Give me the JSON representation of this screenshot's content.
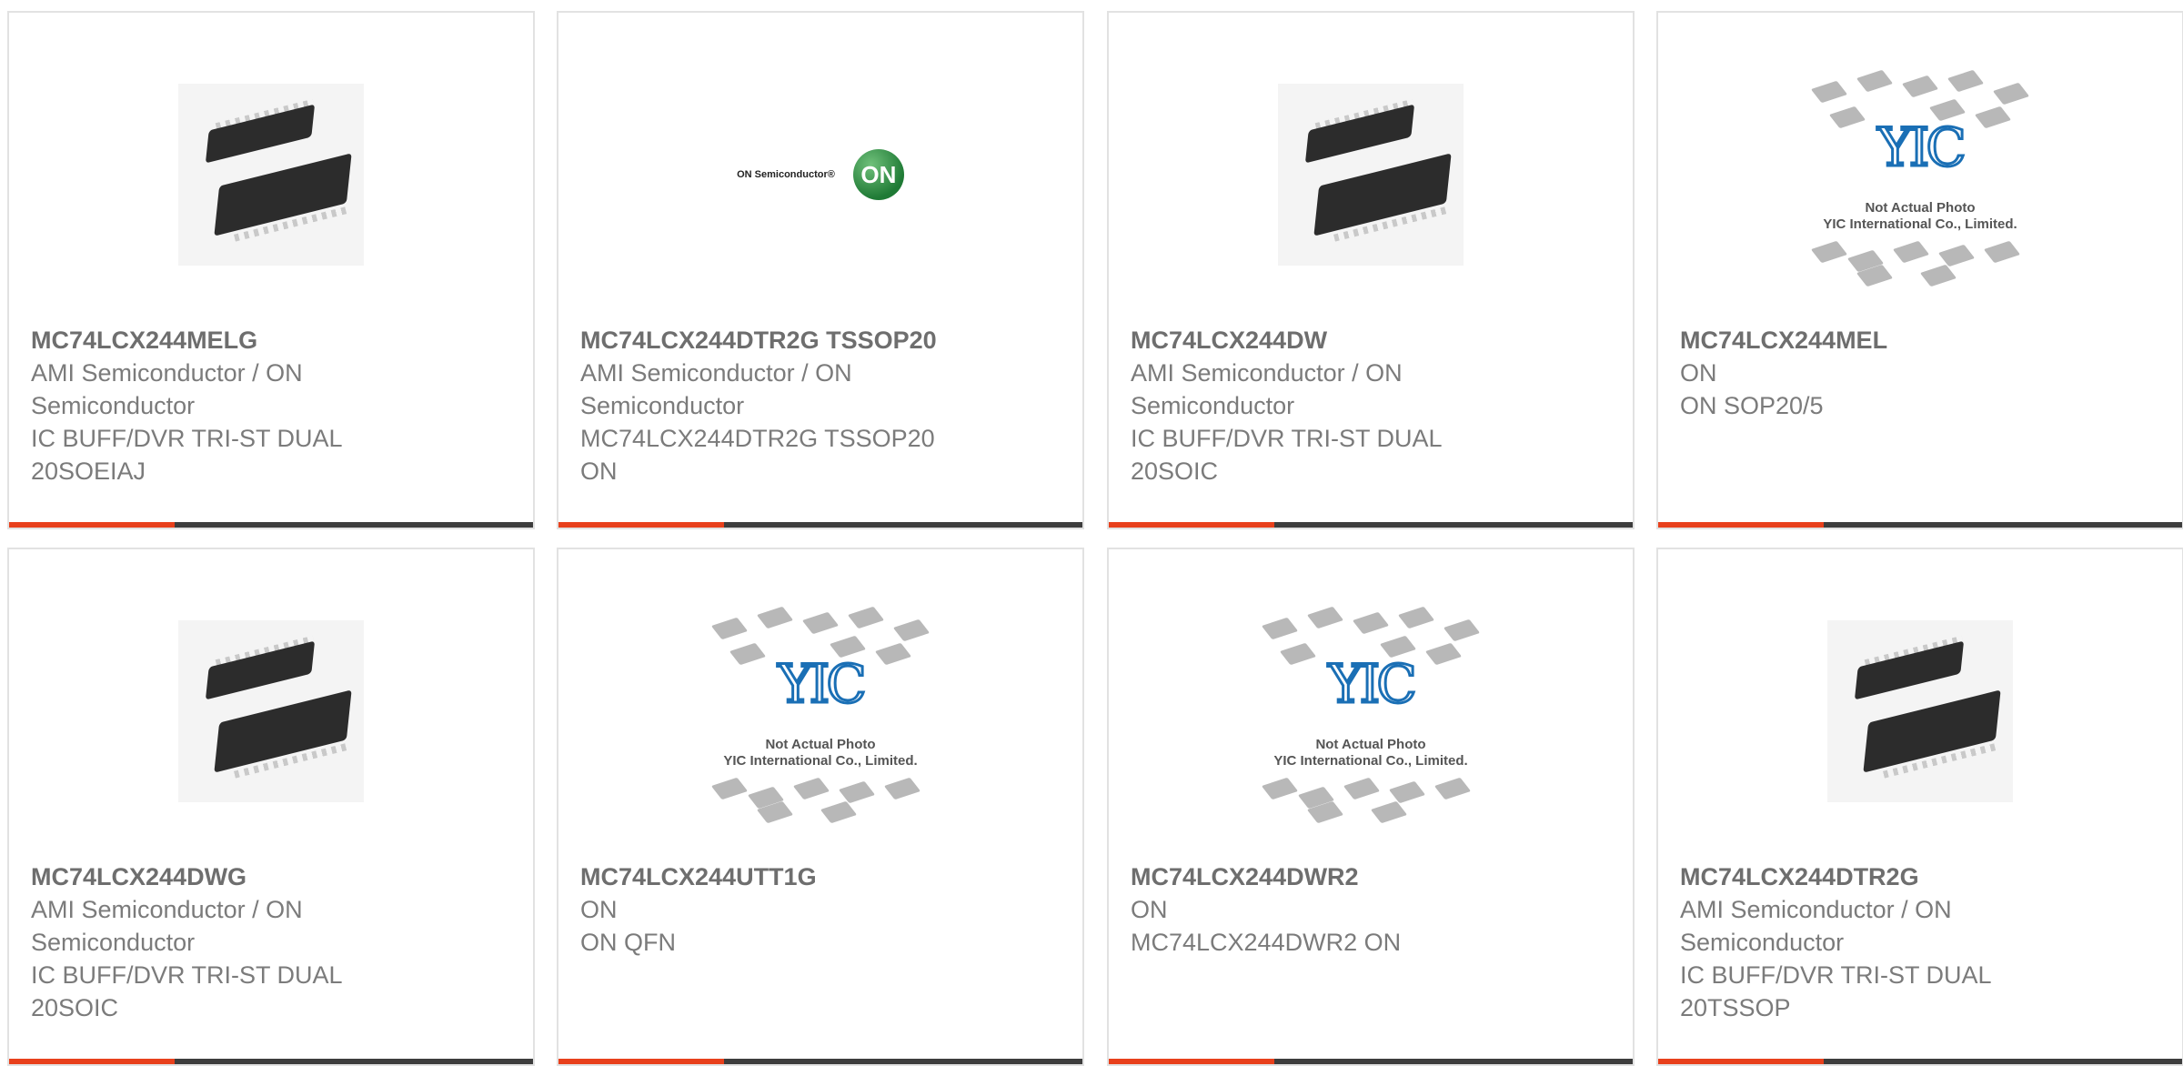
{
  "products": [
    {
      "part_number": "MC74LCX244MELG",
      "lines": [
        "AMI Semiconductor / ON",
        "Semiconductor",
        "IC BUFF/DVR TRI-ST DUAL",
        "20SOEIAJ"
      ],
      "image": "chip-photo"
    },
    {
      "part_number": "MC74LCX244DTR2G TSSOP20",
      "lines": [
        "AMI Semiconductor / ON",
        "Semiconductor",
        "MC74LCX244DTR2G TSSOP20",
        "ON"
      ],
      "image": "on-semiconductor-logo",
      "logo_text": "ON Semiconductor®",
      "logo_mark": "ON"
    },
    {
      "part_number": "MC74LCX244DW",
      "lines": [
        "AMI Semiconductor / ON",
        "Semiconductor",
        "IC BUFF/DVR TRI-ST DUAL",
        "20SOIC"
      ],
      "image": "chip-photo"
    },
    {
      "part_number": "MC74LCX244MEL",
      "lines": [
        "ON",
        "ON SOP20/5"
      ],
      "image": "not-actual-photo",
      "placeholder_mark": "YIC",
      "placeholder_caption": [
        "Not Actual Photo",
        "YIC International Co., Limited."
      ]
    },
    {
      "part_number": "MC74LCX244DWG",
      "lines": [
        "AMI Semiconductor / ON",
        "Semiconductor",
        "IC BUFF/DVR TRI-ST DUAL",
        "20SOIC"
      ],
      "image": "chip-photo"
    },
    {
      "part_number": "MC74LCX244UTT1G",
      "lines": [
        "ON",
        "ON QFN"
      ],
      "image": "not-actual-photo",
      "placeholder_mark": "YIC",
      "placeholder_caption": [
        "Not Actual Photo",
        "YIC International Co., Limited."
      ]
    },
    {
      "part_number": "MC74LCX244DWR2",
      "lines": [
        "ON",
        "MC74LCX244DWR2 ON"
      ],
      "image": "not-actual-photo",
      "placeholder_mark": "YIC",
      "placeholder_caption": [
        "Not Actual Photo",
        "YIC International Co., Limited."
      ]
    },
    {
      "part_number": "MC74LCX244DTR2G",
      "lines": [
        "AMI Semiconductor / ON",
        "Semiconductor",
        "IC BUFF/DVR TRI-ST DUAL",
        "20TSSOP"
      ],
      "image": "chip-photo"
    }
  ],
  "colors": {
    "accent": "#e8401c",
    "bar": "#3d3d3d",
    "card_border": "#e2e2e2",
    "title_text": "#6e6e6e",
    "body_text": "#7b7b7b"
  }
}
